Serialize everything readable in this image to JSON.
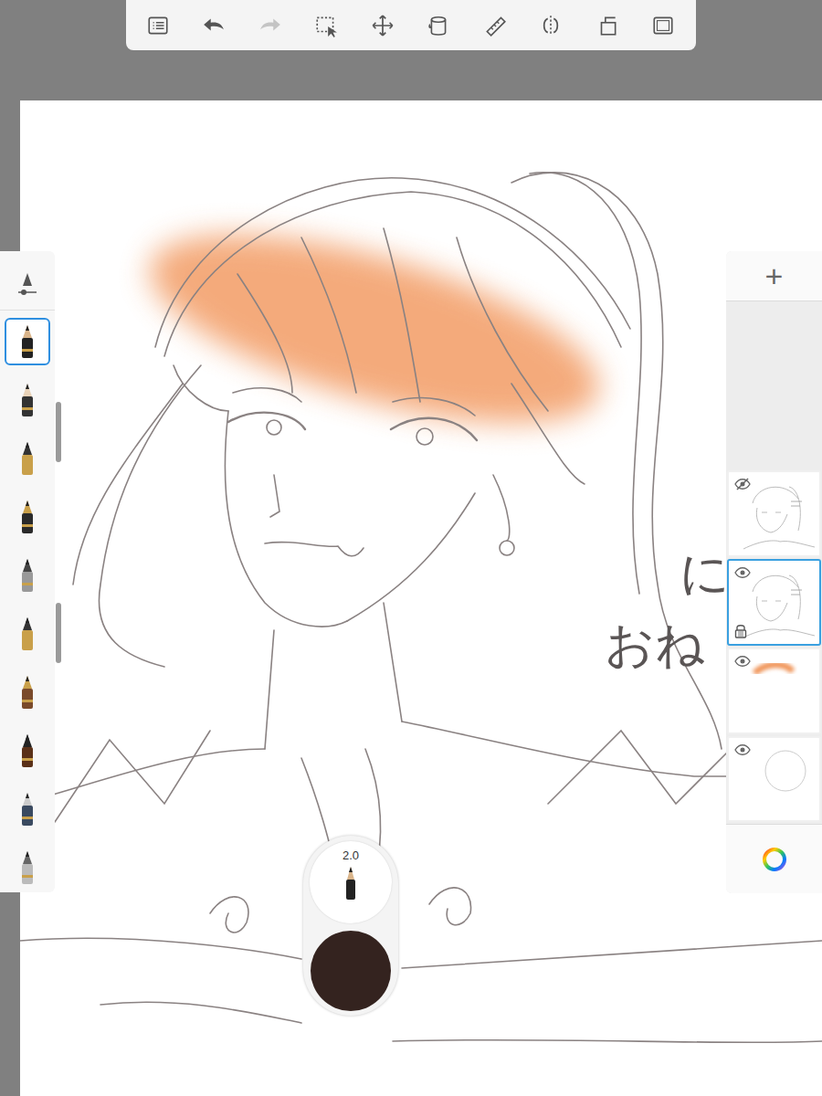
{
  "toolbar": [
    {
      "disabled": false
    },
    {
      "disabled": false
    },
    {
      "disabled": true
    },
    {
      "disabled": false
    },
    {
      "disabled": false
    },
    {
      "disabled": false
    },
    {
      "disabled": false
    },
    {
      "disabled": false
    },
    {
      "disabled": false
    },
    {
      "disabled": false
    }
  ],
  "brushes": [
    {
      "selected": true
    },
    {
      "selected": false
    },
    {
      "selected": false
    },
    {
      "selected": false
    },
    {
      "selected": false
    },
    {
      "selected": false
    },
    {
      "selected": false
    },
    {
      "selected": false
    },
    {
      "selected": false
    },
    {
      "selected": false
    }
  ],
  "layers_panel": {
    "add": "+"
  },
  "layers": [
    {
      "kind": "sketch",
      "visible": false,
      "selected": false,
      "locked": false
    },
    {
      "kind": "sketch",
      "visible": true,
      "selected": true,
      "locked": true
    },
    {
      "kind": "color",
      "visible": true,
      "selected": false,
      "locked": false
    },
    {
      "kind": "background",
      "visible": true,
      "selected": false,
      "locked": false
    }
  ],
  "brush_puck": {
    "size": "2.0",
    "color": "#34231f"
  },
  "canvas": {
    "texts": [
      "に",
      "おね"
    ]
  }
}
